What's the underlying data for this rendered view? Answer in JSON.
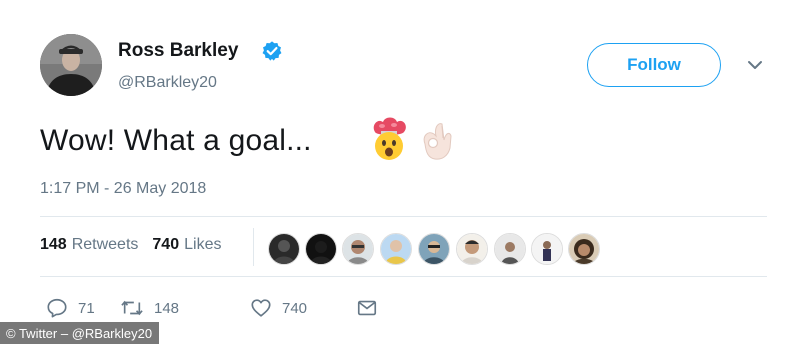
{
  "author": {
    "name": "Ross Barkley",
    "handle": "@RBarkley20",
    "verified": true,
    "avatar_icon": "profile-photo"
  },
  "follow_button": {
    "label": "Follow"
  },
  "menu_icon": "chevron-down-icon",
  "tweet": {
    "text": "Wow! What a goal...",
    "emojis": [
      "exploding-head-emoji",
      "ok-hand-emoji"
    ],
    "timestamp": "1:17 PM - 26 May 2018"
  },
  "stats": {
    "retweets_count": "148",
    "retweets_label": "Retweets",
    "likes_count": "740",
    "likes_label": "Likes"
  },
  "likers": [
    "liker-1",
    "liker-2",
    "liker-3",
    "liker-4",
    "liker-5",
    "liker-6",
    "liker-7",
    "liker-8",
    "liker-9"
  ],
  "actions": {
    "replies": "71",
    "retweets": "148",
    "likes": "740"
  },
  "watermark": "© Twitter – @RBarkley20",
  "colors": {
    "accent": "#1da1f2",
    "text": "#14171a",
    "secondary": "#657786",
    "divider": "#e1e8ed"
  }
}
